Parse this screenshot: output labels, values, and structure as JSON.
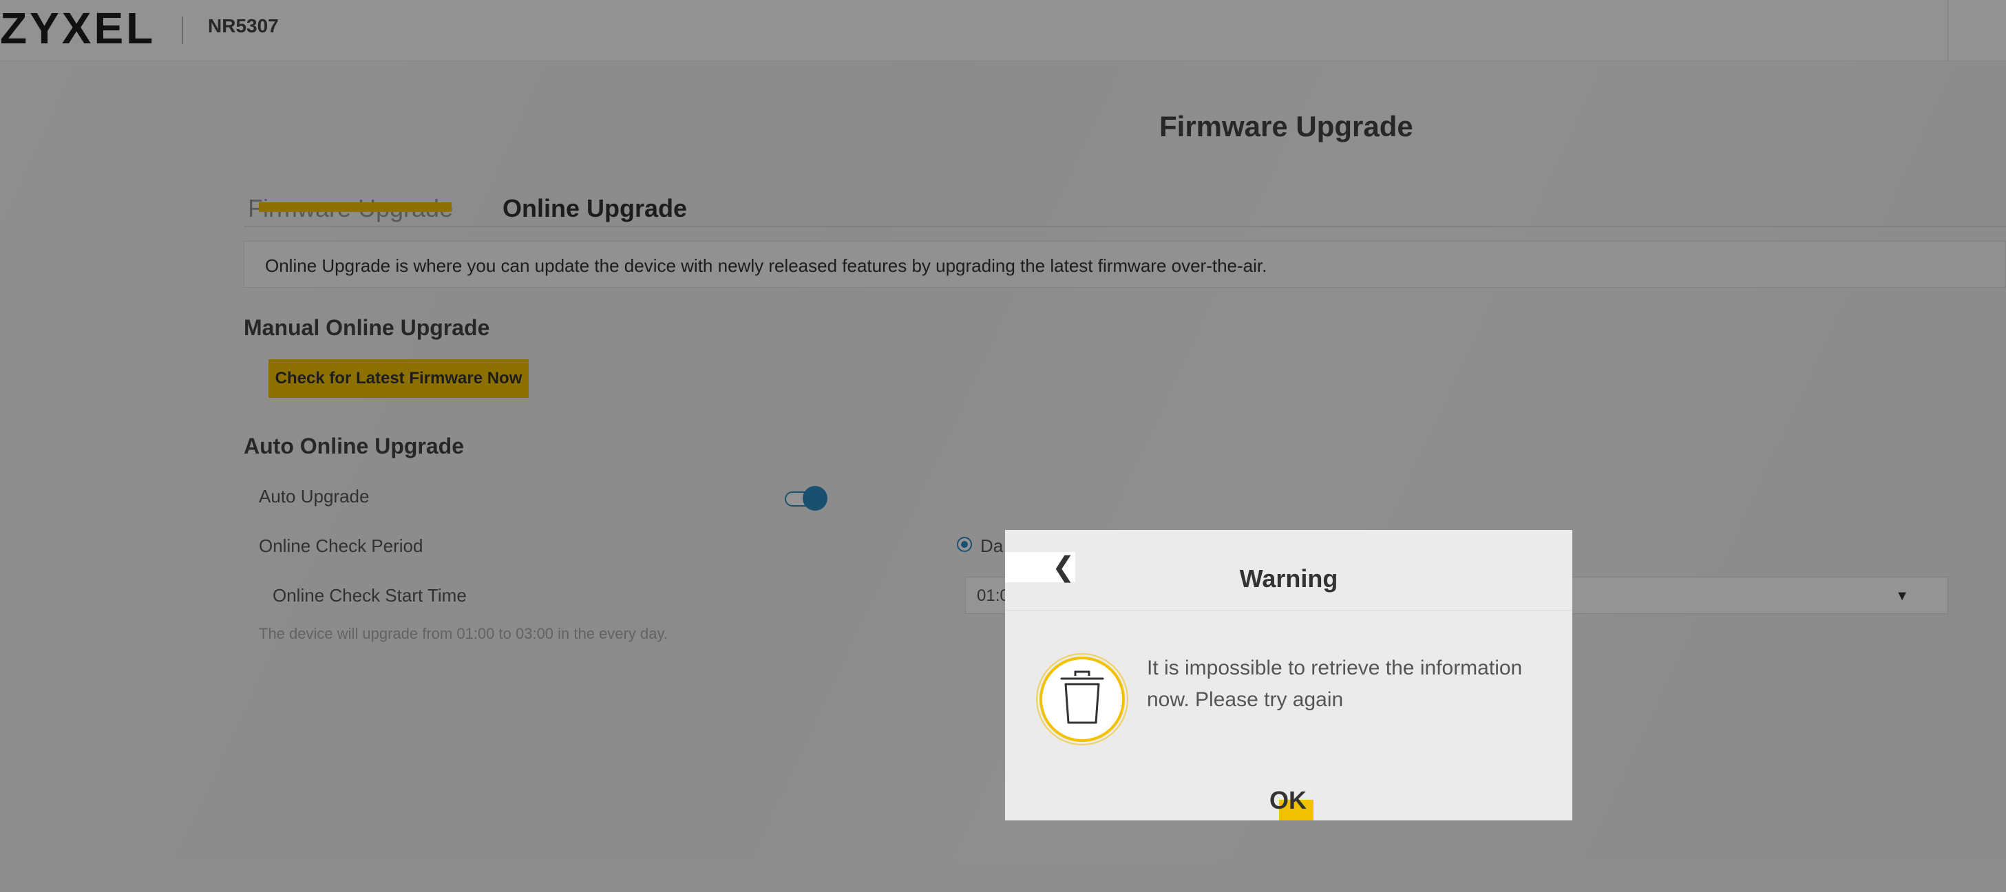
{
  "header": {
    "logo": "ZYXEL",
    "model": "NR5307"
  },
  "page": {
    "title": "Firmware Upgrade",
    "tabs": [
      {
        "label": "Firmware Upgrade",
        "active": false
      },
      {
        "label": "Online Upgrade",
        "active": true
      }
    ],
    "info": "Online Upgrade is where you can update the device with newly released features by upgrading the latest firmware over-the-air."
  },
  "manual": {
    "title": "Manual Online Upgrade",
    "check_button": "Check for Latest Firmware Now"
  },
  "auto": {
    "title": "Auto Online Upgrade",
    "auto_upgrade_label": "Auto Upgrade",
    "auto_upgrade_enabled": true,
    "period_label": "Online Check Period",
    "period_option_visible": "Da",
    "start_time_label": "Online Check Start Time",
    "start_time_value_visible": "01:0",
    "hint": "The device will upgrade from 01:00 to 03:00 in the every day."
  },
  "dialog": {
    "title": "Warning",
    "message": "It is impossible to retrieve the information now. Please try again",
    "ok_label": "OK",
    "icon": "trash-icon",
    "back_icon": "chevron-left-icon"
  },
  "colors": {
    "accent": "#f2c200",
    "toggle": "#2b8ac2",
    "overlay": "rgba(0,0,0,0.42)"
  }
}
